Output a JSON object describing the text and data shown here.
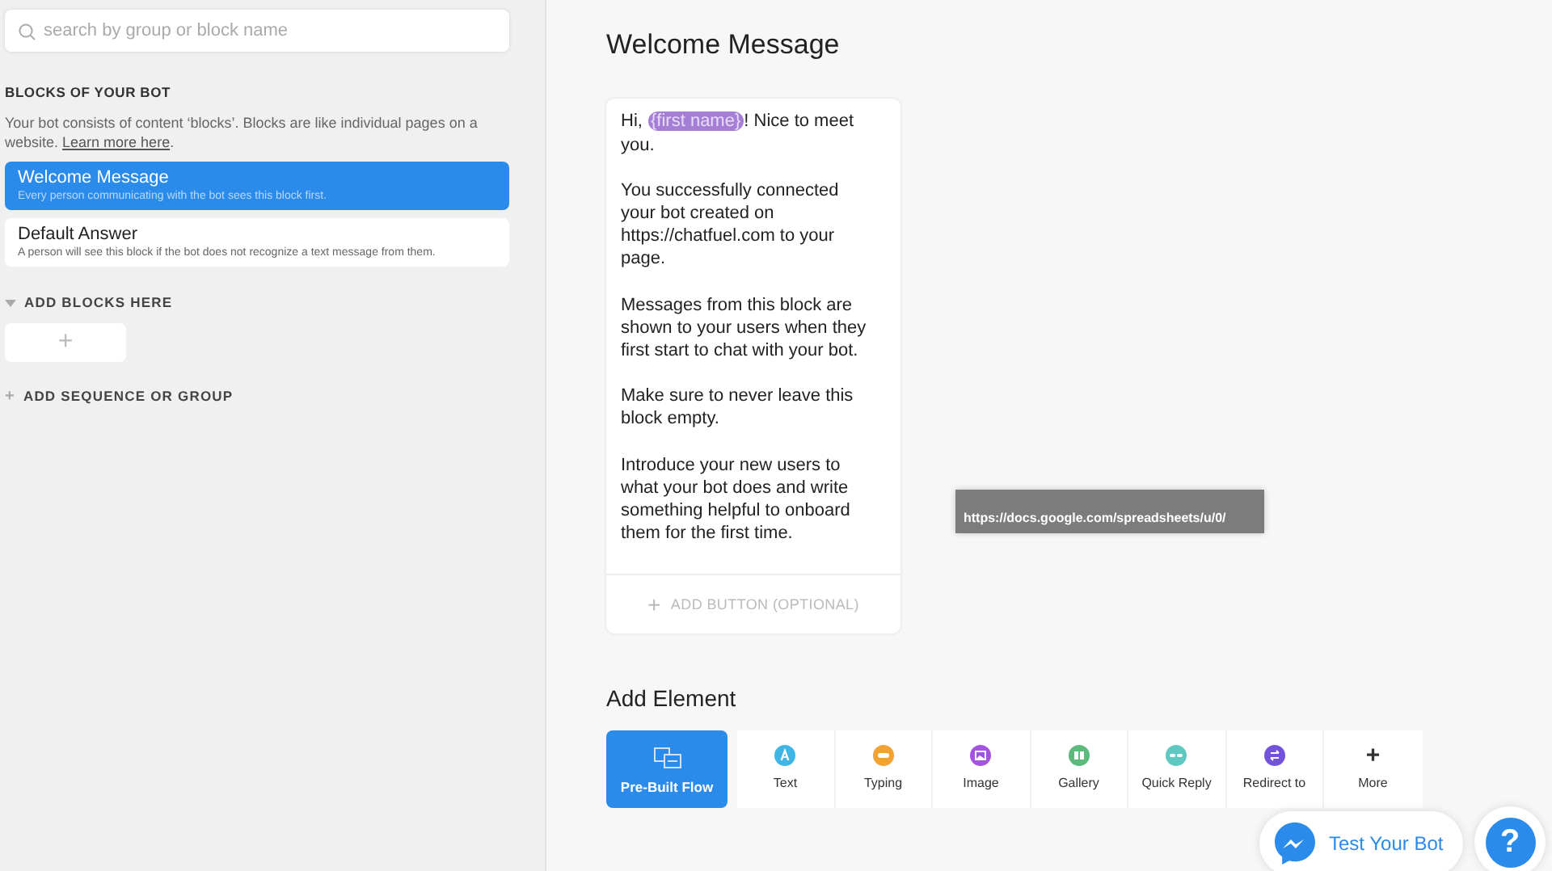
{
  "sidebar": {
    "search": {
      "placeholder": "search by group or block name"
    },
    "section_title": "BLOCKS OF YOUR BOT",
    "description": "Your bot consists of content ‘blocks’. Blocks are like individual pages on a website.",
    "learn_more_link": "Learn more here",
    "description_end": ".",
    "blocks": [
      {
        "title": "Welcome Message",
        "subtitle": "Every person communicating with the bot sees this block first.",
        "selected": true
      },
      {
        "title": "Default Answer",
        "subtitle": "A person will see this block if the bot does not recognize a text message from them.",
        "selected": false
      }
    ],
    "add_blocks": {
      "label": "ADD BLOCKS HERE",
      "expanded": true,
      "add_symbol": "+"
    },
    "add_sequence": {
      "symbol": "+",
      "label": "ADD SEQUENCE OR GROUP"
    }
  },
  "main": {
    "title": "Welcome Message",
    "message_card": {
      "paragraphs": [
        [
          {
            "kind": "text",
            "text": "Hi, "
          },
          {
            "kind": "variable",
            "text": "{first name}"
          },
          {
            "kind": "text",
            "text": "! Nice to meet you."
          }
        ],
        [
          {
            "kind": "text",
            "text": "You successfully connected your bot created on https://chatfuel.com to your page."
          }
        ],
        [
          {
            "kind": "text",
            "text": "Messages from this block are shown to your users when they first start to chat with your bot."
          }
        ],
        [
          {
            "kind": "text",
            "text": "Make sure to never leave this block empty."
          }
        ],
        [
          {
            "kind": "text",
            "text": "Introduce your new users to what your bot does and write something helpful to onboard them for the first time."
          }
        ]
      ],
      "add_button": {
        "symbol": "+",
        "label": "ADD BUTTON (OPTIONAL)"
      }
    },
    "add_element": {
      "title": "Add Element",
      "items": [
        {
          "kind": "flow",
          "label": "Pre-Built Flow",
          "selected": true
        },
        {
          "kind": "text",
          "label": "Text",
          "color": "#3fb5e6",
          "selected": false
        },
        {
          "kind": "typing",
          "label": "Typing",
          "color": "#f1a233",
          "selected": false
        },
        {
          "kind": "image",
          "label": "Image",
          "color": "#a452e0",
          "selected": false
        },
        {
          "kind": "gallery",
          "label": "Gallery",
          "color": "#5cba7c",
          "selected": false
        },
        {
          "kind": "quick_reply",
          "label": "Quick Reply",
          "color": "#5ec8c1",
          "selected": false
        },
        {
          "kind": "redirect",
          "label": "Redirect to",
          "color": "#7453dc",
          "selected": false
        },
        {
          "kind": "more",
          "label": "More",
          "symbol": "+",
          "selected": false
        }
      ]
    }
  },
  "tooltip": "https://docs.google.com/spreadsheets/u/0/",
  "test_bot_button": "Test Your Bot",
  "help_button": "?"
}
